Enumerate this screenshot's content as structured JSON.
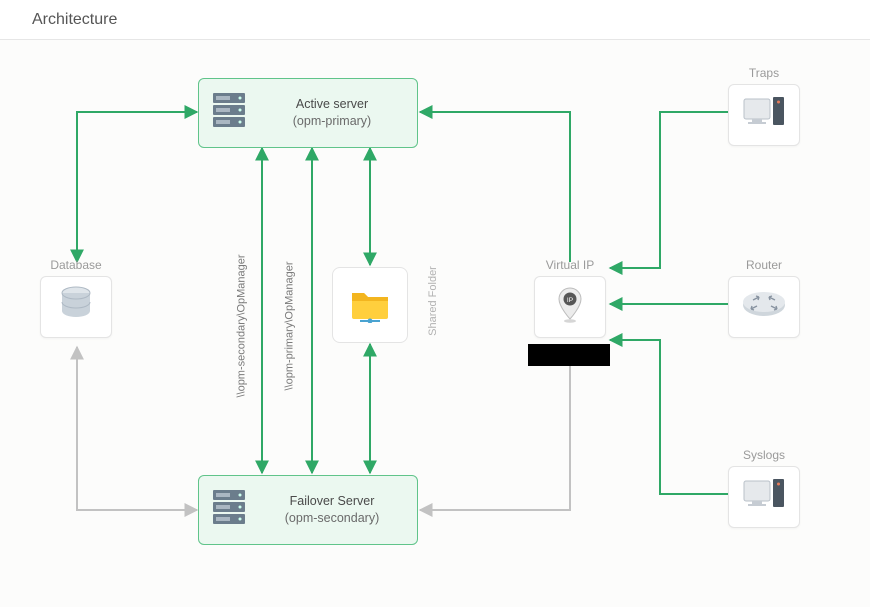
{
  "header": {
    "title": "Architecture"
  },
  "colors": {
    "active": "#2fa866",
    "inactive": "#c2c2c2",
    "boxBorder": "#60c48a",
    "boxFill": "#ebf8f0"
  },
  "nodes": {
    "activeServer": {
      "title": "Active server",
      "subtitle": "(opm-primary)"
    },
    "failoverServer": {
      "title": "Failover Server",
      "subtitle": "(opm-secondary)"
    },
    "database": {
      "label": "Database"
    },
    "virtualIP": {
      "label": "Virtual IP",
      "sub_redacted": true
    },
    "sharedFolder": {
      "label": "Shared Folder"
    },
    "traps": {
      "label": "Traps"
    },
    "router": {
      "label": "Router"
    },
    "syslogs": {
      "label": "Syslogs"
    }
  },
  "edgeLabels": {
    "primaryShare": "\\\\opm-primary\\OpManager",
    "secondaryShare": "\\\\opm-secondary\\OpManager"
  },
  "edges": [
    {
      "from": "database",
      "to": "activeServer",
      "state": "active",
      "bidirectional": false
    },
    {
      "from": "database",
      "to": "failoverServer",
      "state": "inactive",
      "bidirectional": false
    },
    {
      "from": "activeServer",
      "to": "sharedFolder",
      "state": "active",
      "bidirectional": true,
      "label_ref": "primaryShare"
    },
    {
      "from": "failoverServer",
      "to": "sharedFolder",
      "state": "active",
      "bidirectional": true,
      "label_ref": "secondaryShare"
    },
    {
      "from": "virtualIP",
      "to": "activeServer",
      "state": "active",
      "bidirectional": false
    },
    {
      "from": "virtualIP",
      "to": "failoverServer",
      "state": "inactive",
      "bidirectional": false
    },
    {
      "from": "traps",
      "to": "virtualIP",
      "state": "active",
      "bidirectional": false
    },
    {
      "from": "router",
      "to": "virtualIP",
      "state": "active",
      "bidirectional": false
    },
    {
      "from": "syslogs",
      "to": "virtualIP",
      "state": "active",
      "bidirectional": false
    }
  ]
}
